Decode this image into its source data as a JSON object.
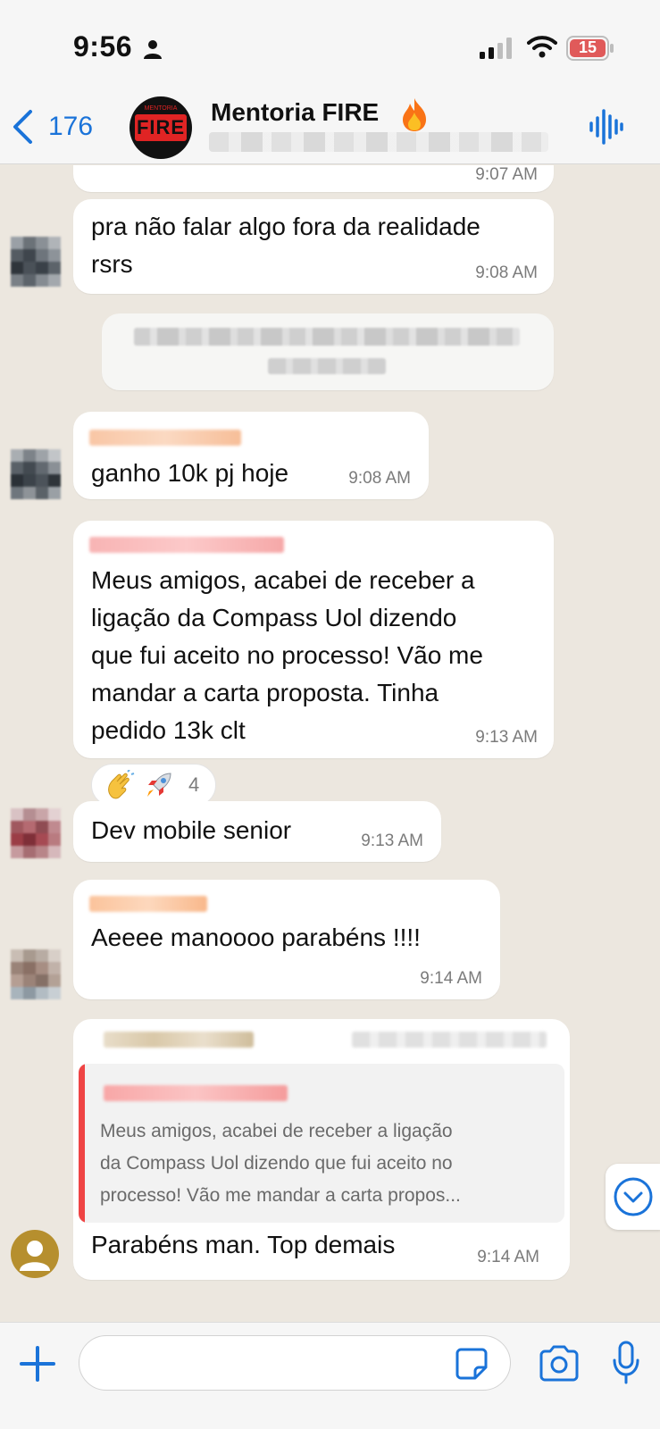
{
  "status_bar": {
    "time": "9:56",
    "battery_level": "15"
  },
  "header": {
    "back_count": "176",
    "group_name": "Mentoria FIRE",
    "avatar_text": "FIRE",
    "avatar_small_text": "MENTORIA"
  },
  "messages": [
    {
      "text": "",
      "time": "9:07 AM"
    },
    {
      "text": "pra não falar algo fora da realidade\nrsrs",
      "time": "9:08 AM"
    },
    {
      "text": "ganho 10k pj hoje",
      "time": "9:08 AM"
    },
    {
      "text": "Meus amigos, acabei de receber a\nligação da Compass Uol dizendo\nque fui aceito no processo! Vão me\nmandar a carta proposta. Tinha\npedido 13k clt",
      "time": "9:13 AM"
    },
    {
      "text": "Dev mobile senior",
      "time": "9:13 AM"
    },
    {
      "text": "Aeeee manoooo parabéns !!!!",
      "time": "9:14 AM"
    },
    {
      "text": "Parabéns man. Top demais",
      "time": "9:14 AM"
    }
  ],
  "reactions": {
    "count": "4",
    "emojis": [
      "clapping-hands",
      "rocket"
    ]
  },
  "quoted_message": {
    "text": "Meus amigos, acabei de receber a ligação\nda Compass Uol dizendo que fui aceito no\nprocesso! Vão me mandar a carta propos..."
  },
  "input_bar": {
    "placeholder": ""
  },
  "colors": {
    "accent": "#1a73d9",
    "chat_background": "#ece7df",
    "bubble": "#ffffff",
    "quote_bar": "#ef4444"
  }
}
